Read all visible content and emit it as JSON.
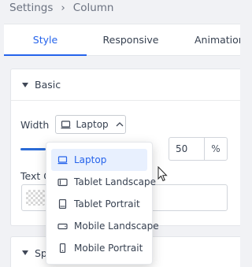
{
  "breadcrumb": {
    "root": "Settings",
    "separator": "›",
    "current": "Column"
  },
  "tabs": [
    {
      "label": "Style",
      "active": true
    },
    {
      "label": "Responsive",
      "active": false
    },
    {
      "label": "Animation",
      "active": false
    }
  ],
  "basic": {
    "title": "Basic",
    "width_label": "Width",
    "device_selected": "Laptop",
    "width_value": "50",
    "width_unit": "%",
    "text_color_label": "Text Color"
  },
  "spacing": {
    "title": "Spacing"
  },
  "device_menu": {
    "options": [
      {
        "label": "Laptop",
        "icon": "laptop-icon",
        "selected": true
      },
      {
        "label": "Tablet Landscape",
        "icon": "tablet-landscape-icon",
        "selected": false
      },
      {
        "label": "Tablet Portrait",
        "icon": "tablet-portrait-icon",
        "selected": false
      },
      {
        "label": "Mobile Landscape",
        "icon": "mobile-landscape-icon",
        "selected": false
      },
      {
        "label": "Mobile Portrait",
        "icon": "mobile-portrait-icon",
        "selected": false
      }
    ]
  },
  "colors": {
    "accent": "#2563eb",
    "selected_bg": "#e8f0fe"
  }
}
